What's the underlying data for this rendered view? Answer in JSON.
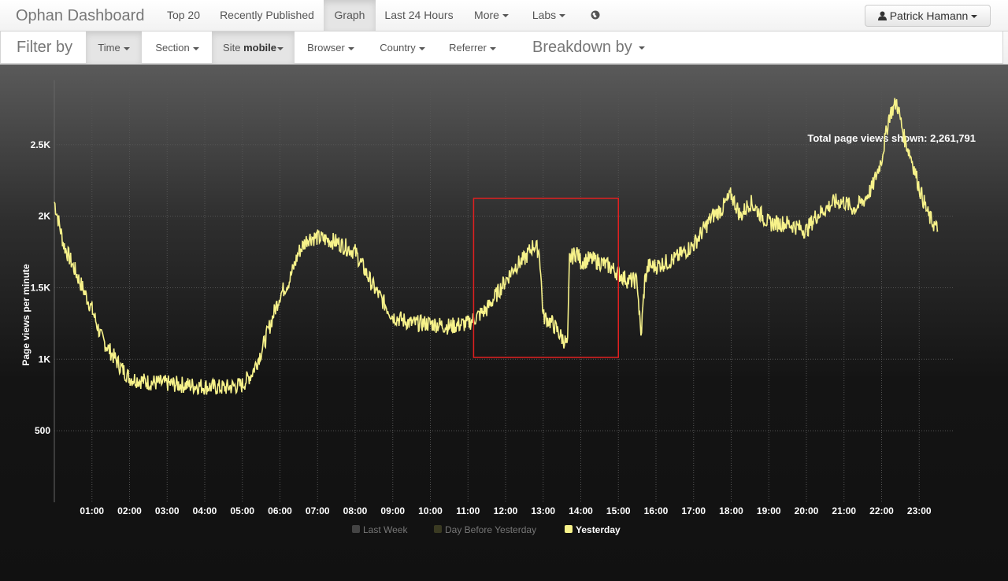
{
  "topnav": {
    "brand": "Ophan Dashboard",
    "items": [
      "Top 20",
      "Recently Published",
      "Graph",
      "Last 24 Hours",
      "More",
      "Labs"
    ],
    "active": "Graph",
    "user": "Patrick Hamann"
  },
  "filterbar": {
    "label": "Filter by",
    "time": "Time",
    "section": "Section",
    "site_prefix": "Site",
    "site_value": "mobile",
    "browser": "Browser",
    "country": "Country",
    "referrer": "Referrer",
    "breakdown": "Breakdown by"
  },
  "summary": {
    "label": "Total page views shown:",
    "value": "2,261,791"
  },
  "chart_data": {
    "type": "line",
    "ylabel": "Page views per minute",
    "ylim": [
      0,
      2950
    ],
    "y_ticks": [
      500,
      1000,
      1500,
      2000,
      2500
    ],
    "y_tick_labels": [
      "500",
      "1K",
      "1.5K",
      "2K",
      "2.5K"
    ],
    "x_tick_labels": [
      "01:00",
      "02:00",
      "03:00",
      "04:00",
      "05:00",
      "06:00",
      "07:00",
      "08:00",
      "09:00",
      "10:00",
      "11:00",
      "12:00",
      "13:00",
      "14:00",
      "15:00",
      "16:00",
      "17:00",
      "18:00",
      "19:00",
      "20:00",
      "21:00",
      "22:00",
      "23:00"
    ],
    "grid": true,
    "legend_position": "bottom-center",
    "series": [
      {
        "name": "Yesterday",
        "color": "#f7f28a",
        "x_hours": [
          0,
          0.25,
          0.5,
          0.75,
          1,
          1.25,
          1.5,
          1.75,
          2,
          2.5,
          3,
          3.5,
          4,
          4.5,
          5,
          5.25,
          5.5,
          5.75,
          6,
          6.25,
          6.5,
          6.75,
          7,
          7.5,
          8,
          8.5,
          9,
          9.5,
          10,
          10.5,
          11,
          11.25,
          11.5,
          11.75,
          12,
          12.25,
          12.5,
          12.75,
          12.9,
          13,
          13.25,
          13.5,
          13.65,
          13.7,
          13.9,
          14,
          14.25,
          14.5,
          14.75,
          15,
          15.25,
          15.5,
          15.6,
          15.7,
          15.8,
          16,
          16.5,
          17,
          17.25,
          17.5,
          17.75,
          18,
          18.25,
          18.5,
          19,
          19.5,
          20,
          20.25,
          20.5,
          20.75,
          21,
          21.25,
          21.5,
          21.75,
          22,
          22.2,
          22.4,
          22.6,
          22.8,
          23,
          23.25,
          23.5
        ],
        "y": [
          2100,
          1800,
          1650,
          1500,
          1350,
          1150,
          1050,
          950,
          870,
          840,
          830,
          820,
          810,
          800,
          820,
          900,
          1050,
          1250,
          1450,
          1550,
          1750,
          1850,
          1850,
          1820,
          1750,
          1500,
          1300,
          1250,
          1250,
          1230,
          1250,
          1300,
          1350,
          1450,
          1550,
          1650,
          1700,
          1800,
          1750,
          1300,
          1250,
          1150,
          1100,
          1700,
          1750,
          1680,
          1700,
          1680,
          1650,
          1600,
          1550,
          1550,
          1150,
          1550,
          1650,
          1650,
          1700,
          1800,
          1900,
          2000,
          2050,
          2150,
          2000,
          2100,
          1950,
          1950,
          1900,
          2000,
          2050,
          2100,
          2100,
          2050,
          2100,
          2200,
          2400,
          2700,
          2800,
          2550,
          2400,
          2200,
          2000,
          1900
        ]
      }
    ],
    "legend": [
      {
        "label": "Last Week",
        "color": "#444444"
      },
      {
        "label": "Day Before Yesterday",
        "color": "#3a3a22"
      },
      {
        "label": "Yesterday",
        "color": "#f7f28a"
      }
    ],
    "highlight_box": {
      "x_start_hours": 11.15,
      "x_end_hours": 15.0,
      "y_low": 1000,
      "y_high": 1100
    }
  }
}
